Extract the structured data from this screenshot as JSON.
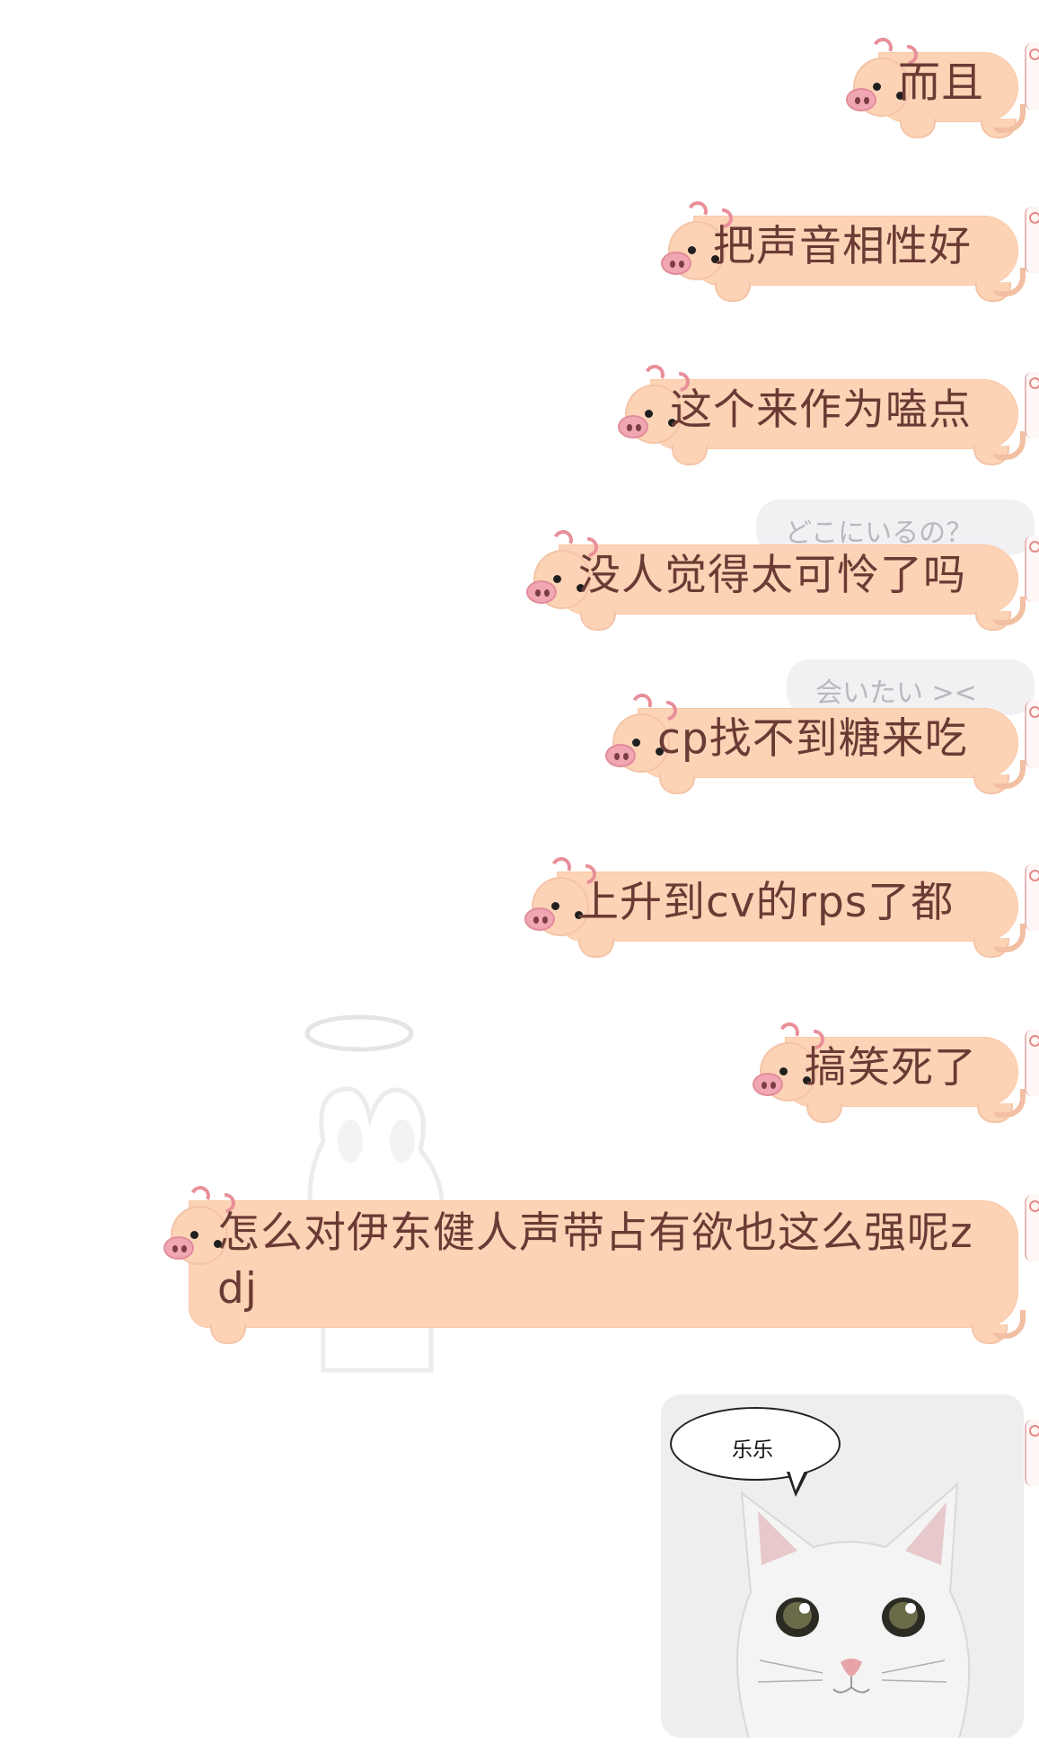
{
  "messages": [
    {
      "text": "而且"
    },
    {
      "text": "把声音相性好"
    },
    {
      "text": "这个来作为嗑点"
    },
    {
      "text": "没人觉得太可怜了吗"
    },
    {
      "text": "cp找不到糖来吃"
    },
    {
      "text": "上升到cv的rps了都"
    },
    {
      "text": "搞笑死了"
    },
    {
      "text": "怎么对伊东健人声带占有欲也这么强呢zdj"
    }
  ],
  "background_bubbles": [
    {
      "text": "どこにいるの？"
    },
    {
      "text": "会いたい ><"
    }
  ],
  "sticker": {
    "speech_text": "乐乐",
    "subject": "white-cat"
  },
  "colors": {
    "pig_bubble": "#fdd3b6",
    "pig_text": "#6a3b34",
    "snout": "#f0a7b3"
  }
}
